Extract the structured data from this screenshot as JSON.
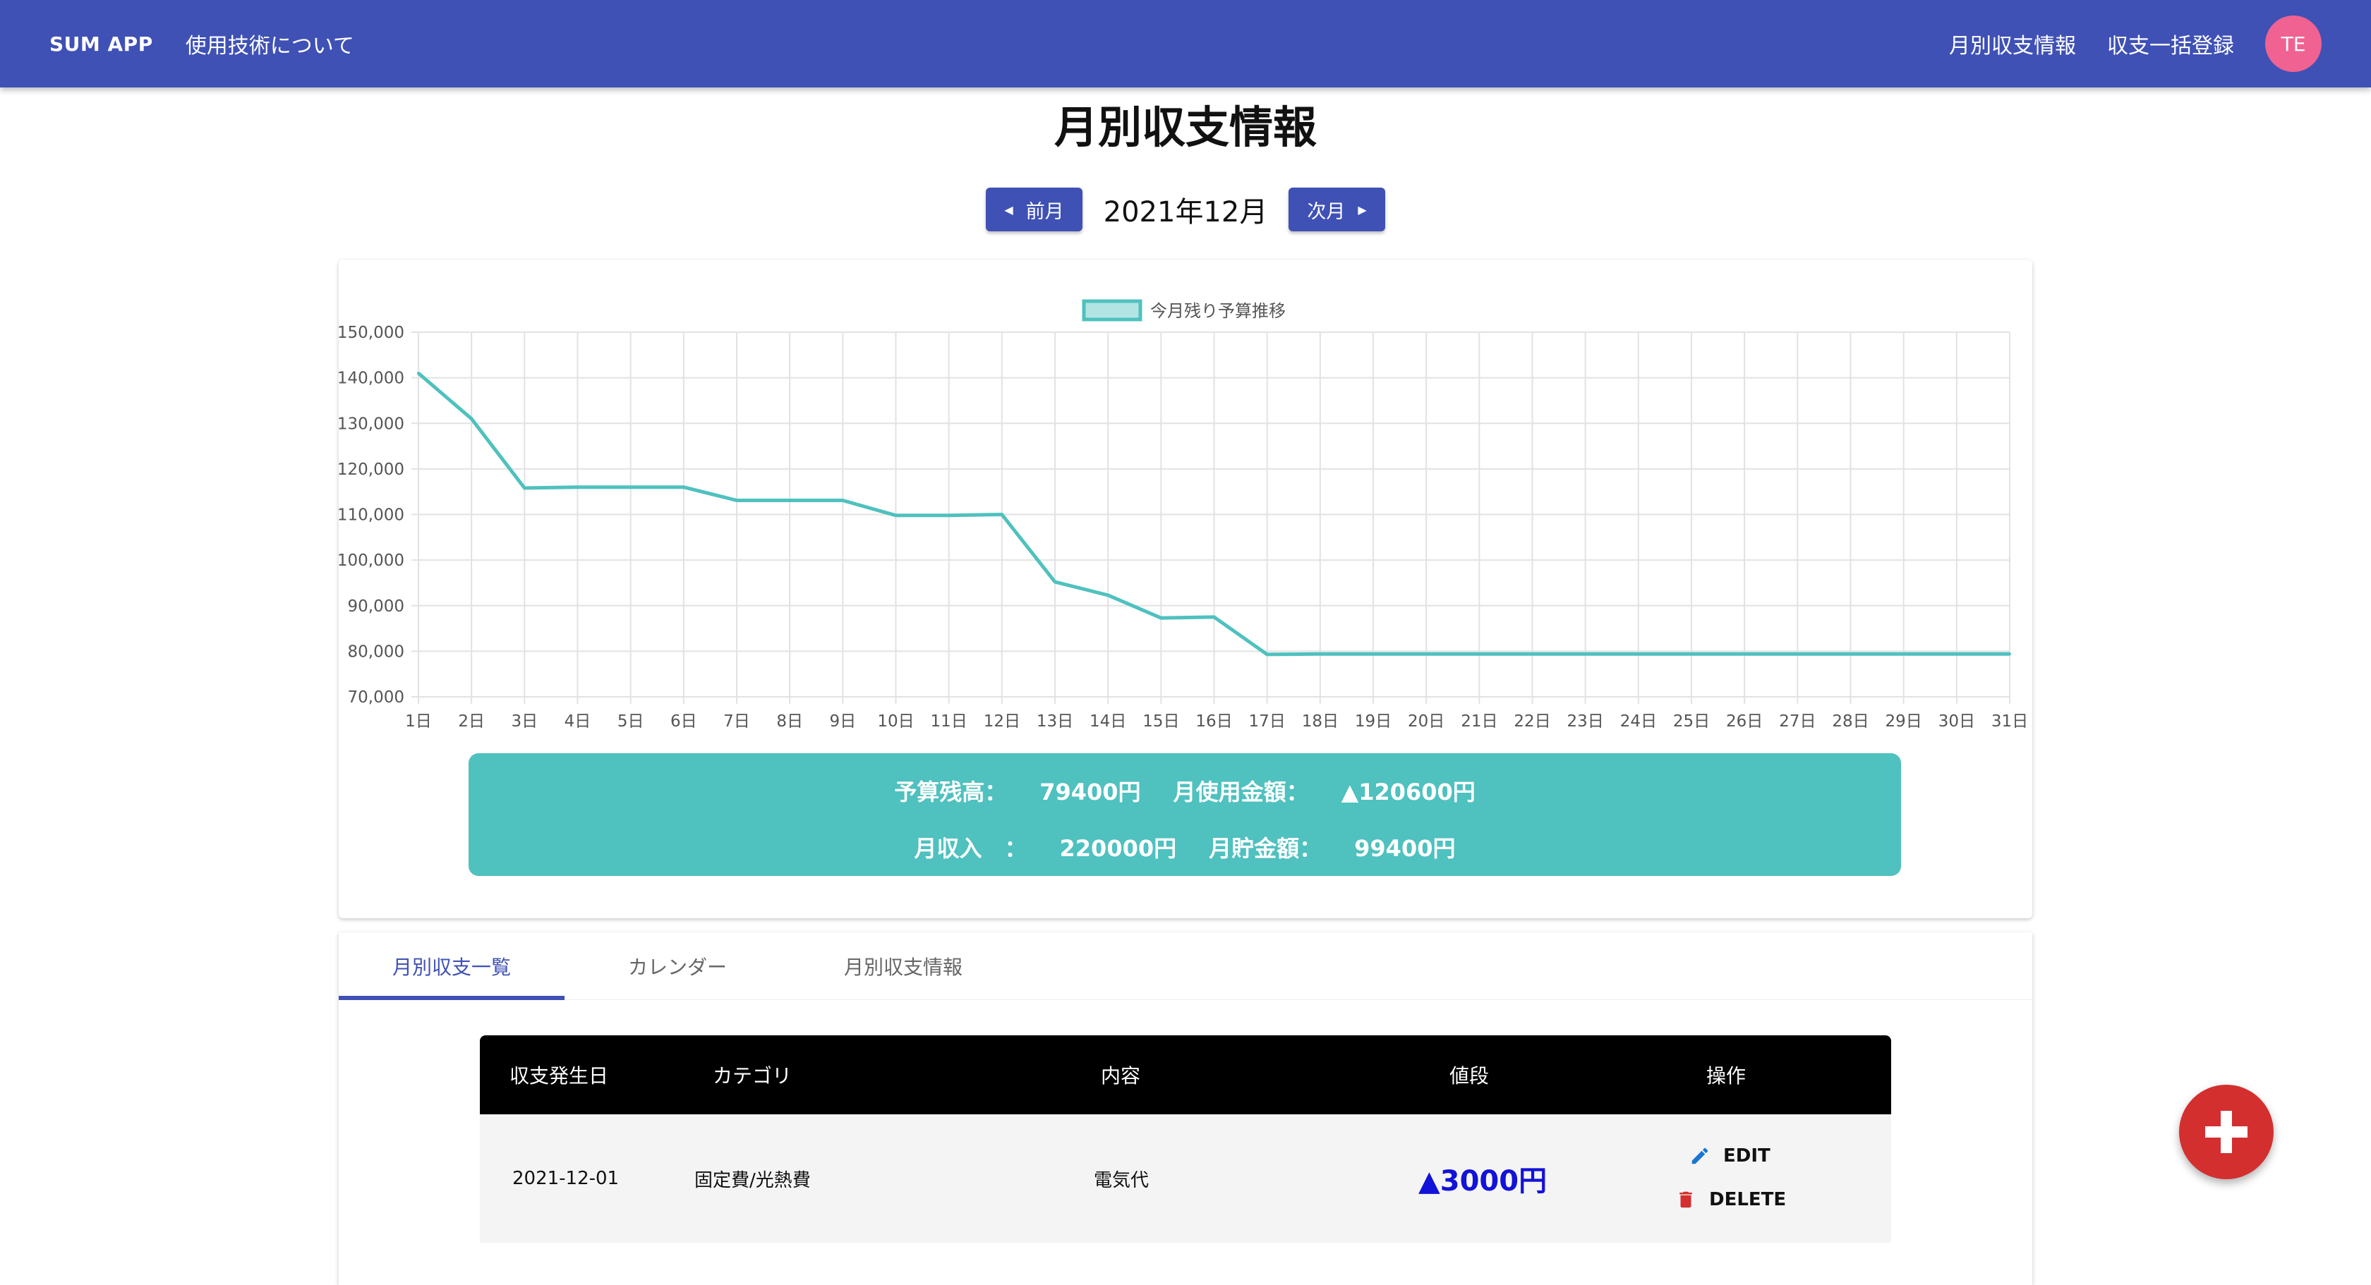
{
  "appbar": {
    "brand": "SUM APP",
    "left_link": "使用技術について",
    "right_links": [
      "月別収支情報",
      "収支一括登録"
    ],
    "avatar_initials": "TE",
    "colors": {
      "primary": "#3f51b5",
      "avatar": "#f06292"
    }
  },
  "page": {
    "title": "月別収支情報",
    "month_label": "2021年12月",
    "prev_label": "前月",
    "next_label": "次月"
  },
  "chart_data": {
    "type": "line",
    "legend": "今月残り予算推移",
    "legend_placement": "top-center",
    "line_color": "#4fc1bf",
    "grid": true,
    "ylim": [
      70000,
      150000
    ],
    "y_ticks": [
      "150,000",
      "140,000",
      "130,000",
      "120,000",
      "110,000",
      "100,000",
      "90,000",
      "80,000",
      "70,000"
    ],
    "categories": [
      "1日",
      "2日",
      "3日",
      "4日",
      "5日",
      "6日",
      "7日",
      "8日",
      "9日",
      "10日",
      "11日",
      "12日",
      "13日",
      "14日",
      "15日",
      "16日",
      "17日",
      "18日",
      "19日",
      "20日",
      "21日",
      "22日",
      "23日",
      "24日",
      "25日",
      "26日",
      "27日",
      "28日",
      "29日",
      "30日",
      "31日"
    ],
    "values": [
      141000,
      131000,
      115800,
      116000,
      116000,
      116000,
      113100,
      113100,
      113100,
      109800,
      109800,
      110000,
      95200,
      92300,
      87300,
      87500,
      79300,
      79400,
      79400,
      79400,
      79400,
      79400,
      79400,
      79400,
      79400,
      79400,
      79400,
      79400,
      79400,
      79400,
      79400
    ]
  },
  "summary": {
    "balance_label": "予算残高：",
    "balance_value": "79400円",
    "used_label": "月使用金額：",
    "used_value": "▲120600円",
    "income_label": "月収入　：",
    "income_value": "220000円",
    "savings_label": "月貯金額：",
    "savings_value": "99400円"
  },
  "tabs": [
    "月別収支一覧",
    "カレンダー",
    "月別収支情報"
  ],
  "table": {
    "headers": [
      "収支発生日",
      "カテゴリ",
      "内容",
      "値段",
      "操作"
    ],
    "rows": [
      {
        "date": "2021-12-01",
        "category": "固定費/光熱費",
        "content": "電気代",
        "price": "▲3000円"
      }
    ],
    "edit_label": "EDIT",
    "delete_label": "DELETE"
  }
}
